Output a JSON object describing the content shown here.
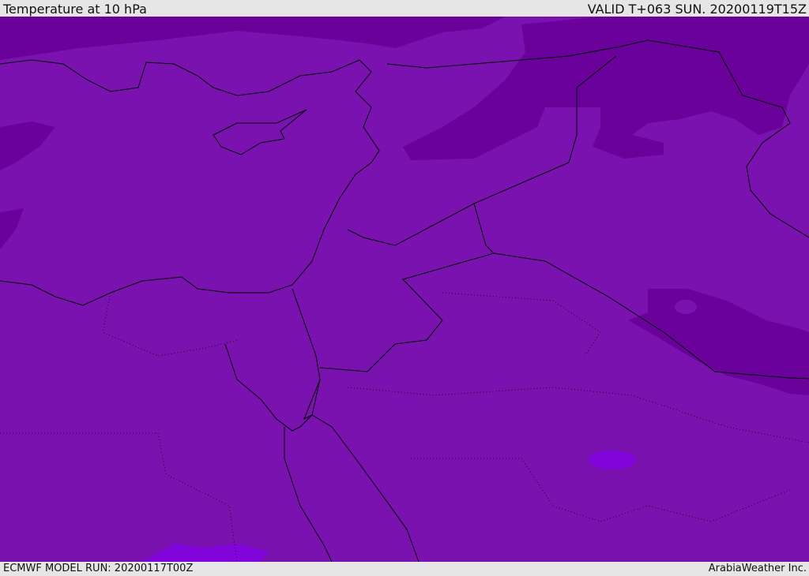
{
  "header": {
    "title": "Temperature at 10 hPa",
    "valid": "VALID T+063 SUN. 20200119T15Z"
  },
  "footer": {
    "model_run": "ECMWF MODEL RUN: 20200117T00Z",
    "credit": "ArabiaWeather Inc."
  },
  "colors": {
    "base": "#7a12b0",
    "cold": "#6a019a",
    "warm": "#8206dc",
    "line": "#000000"
  }
}
